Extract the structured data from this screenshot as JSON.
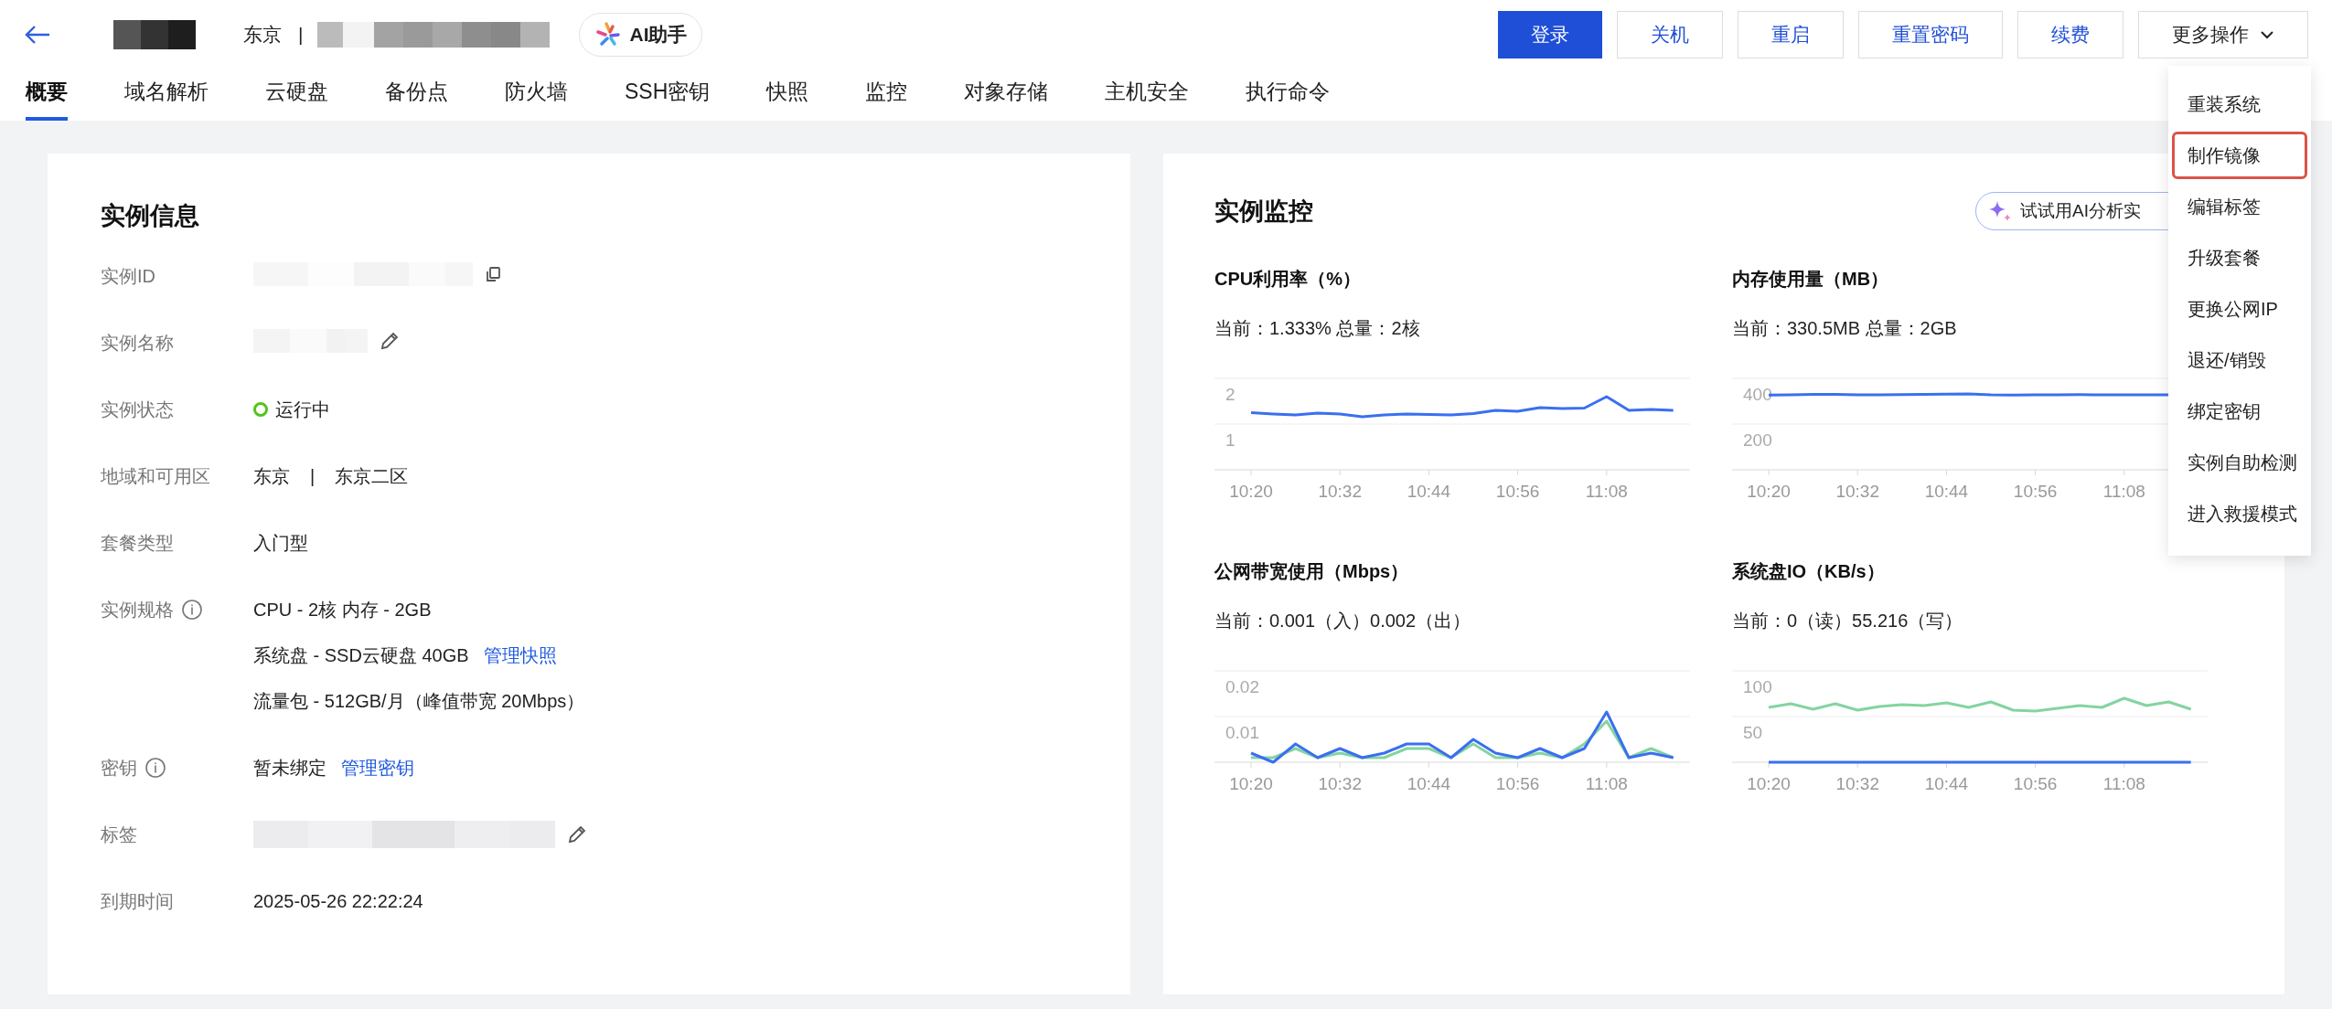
{
  "header": {
    "location": "东京",
    "separator": "|",
    "ai_button": "AI助手",
    "buttons": [
      {
        "label": "登录",
        "kind": "primary"
      },
      {
        "label": "关机",
        "kind": "default"
      },
      {
        "label": "重启",
        "kind": "default"
      },
      {
        "label": "重置密码",
        "kind": "default"
      },
      {
        "label": "续费",
        "kind": "default"
      },
      {
        "label": "更多操作",
        "kind": "menu"
      }
    ]
  },
  "tabs": [
    {
      "label": "概要",
      "selected": true
    },
    {
      "label": "域名解析",
      "selected": false
    },
    {
      "label": "云硬盘",
      "selected": false
    },
    {
      "label": "备份点",
      "selected": false
    },
    {
      "label": "防火墙",
      "selected": false
    },
    {
      "label": "SSH密钥",
      "selected": false
    },
    {
      "label": "快照",
      "selected": false
    },
    {
      "label": "监控",
      "selected": false
    },
    {
      "label": "对象存储",
      "selected": false
    },
    {
      "label": "主机安全",
      "selected": false
    },
    {
      "label": "执行命令",
      "selected": false
    }
  ],
  "instance_info": {
    "title": "实例信息",
    "rows": [
      {
        "label": "实例ID",
        "info": false,
        "kind": "redacted_copy"
      },
      {
        "label": "实例名称",
        "info": false,
        "kind": "redacted_edit"
      },
      {
        "label": "实例状态",
        "info": false,
        "kind": "status",
        "value": "运行中",
        "color": "#52c41a"
      },
      {
        "label": "地域和可用区",
        "info": false,
        "kind": "parts",
        "values": [
          "东京",
          "|",
          "东京二区"
        ]
      },
      {
        "label": "套餐类型",
        "info": false,
        "kind": "text",
        "lines": [
          {
            "text": "入门型"
          }
        ]
      },
      {
        "label": "实例规格",
        "info": true,
        "kind": "text",
        "lines": [
          {
            "text": "CPU - 2核 内存 - 2GB"
          },
          {
            "text": "系统盘 - SSD云硬盘 40GB",
            "link": "管理快照"
          },
          {
            "text": "流量包 - 512GB/月（峰值带宽 20Mbps）"
          }
        ]
      },
      {
        "label": "密钥",
        "info": true,
        "kind": "text",
        "lines": [
          {
            "text": "暂未绑定",
            "link": "管理密钥"
          }
        ]
      },
      {
        "label": "标签",
        "info": false,
        "kind": "redacted_edit"
      },
      {
        "label": "到期时间",
        "info": false,
        "kind": "text",
        "lines": [
          {
            "text": "2025-05-26 22:22:24"
          }
        ]
      }
    ]
  },
  "monitor": {
    "title": "实例监控",
    "ai_button": "试试用AI分析实",
    "charts": [
      {
        "title": "CPU利用率（%）",
        "current": "当前：1.333% 总量：2核",
        "chart_data": {
          "type": "line",
          "categories": [
            "10:20",
            null,
            null,
            null,
            "10:32",
            null,
            null,
            null,
            "10:44",
            null,
            null,
            null,
            "10:56",
            null,
            null,
            null,
            "11:08",
            null,
            null,
            null
          ],
          "ylim": [
            0,
            2
          ],
          "yticks": [
            1,
            2
          ],
          "series": [
            {
              "color": "#3a6ff0",
              "values": [
                1.25,
                1.22,
                1.2,
                1.24,
                1.22,
                1.16,
                1.2,
                1.22,
                1.21,
                1.2,
                1.23,
                1.3,
                1.28,
                1.36,
                1.34,
                1.35,
                1.6,
                1.3,
                1.32,
                1.3
              ]
            }
          ]
        }
      },
      {
        "title": "内存使用量（MB）",
        "current": "当前：330.5MB 总量：2GB",
        "chart_data": {
          "type": "line",
          "categories": [
            "10:20",
            null,
            null,
            null,
            "10:32",
            null,
            null,
            null,
            "10:44",
            null,
            null,
            null,
            "10:56",
            null,
            null,
            null,
            "11:08",
            null,
            null,
            null
          ],
          "ylim": [
            0,
            400
          ],
          "yticks": [
            200,
            400
          ],
          "series": [
            {
              "color": "#3a6ff0",
              "values": [
                327,
                328,
                330,
                330,
                328,
                328,
                329,
                330,
                331,
                332,
                328,
                327,
                328,
                328,
                329,
                328,
                328,
                328,
                328,
                null
              ]
            }
          ]
        }
      },
      {
        "title": "公网带宽使用（Mbps）",
        "current": "当前：0.001（入）0.002（出）",
        "chart_data": {
          "type": "line",
          "categories": [
            "10:20",
            null,
            null,
            null,
            "10:32",
            null,
            null,
            null,
            "10:44",
            null,
            null,
            null,
            "10:56",
            null,
            null,
            null,
            "11:08",
            null,
            null,
            null
          ],
          "ylim": [
            0,
            0.02
          ],
          "yticks": [
            0.01,
            0.02
          ],
          "series": [
            {
              "color": "#84d4a0",
              "values": [
                0.001,
                0.001,
                0.003,
                0.001,
                0.002,
                0.001,
                0.001,
                0.003,
                0.003,
                0.001,
                0.004,
                0.001,
                0.001,
                0.002,
                0.001,
                0.004,
                0.009,
                0.001,
                0.003,
                0.001
              ]
            },
            {
              "color": "#3a6ff0",
              "values": [
                0.002,
                0.0,
                0.004,
                0.001,
                0.003,
                0.001,
                0.002,
                0.004,
                0.004,
                0.001,
                0.005,
                0.002,
                0.001,
                0.003,
                0.001,
                0.003,
                0.011,
                0.001,
                0.002,
                0.001
              ]
            }
          ]
        }
      },
      {
        "title": "系统盘IO（KB/s）",
        "current": "当前：0（读）55.216（写）",
        "chart_data": {
          "type": "line",
          "categories": [
            "10:20",
            null,
            null,
            null,
            "10:32",
            null,
            null,
            null,
            "10:44",
            null,
            null,
            null,
            "10:56",
            null,
            null,
            null,
            "11:08",
            null,
            null,
            null
          ],
          "ylim": [
            0,
            100
          ],
          "yticks": [
            50,
            100
          ],
          "series": [
            {
              "color": "#84d4a0",
              "values": [
                60,
                64,
                58,
                64,
                57,
                61,
                63,
                62,
                65,
                60,
                66,
                57,
                56,
                59,
                62,
                60,
                70,
                62,
                66,
                58
              ]
            },
            {
              "color": "#3a6ff0",
              "values": [
                0,
                0,
                0,
                0,
                0,
                0,
                0,
                0,
                0,
                0,
                0,
                0,
                0,
                0,
                0,
                0,
                0,
                0,
                0,
                0
              ]
            }
          ]
        }
      }
    ]
  },
  "more_menu": {
    "items": [
      {
        "label": "重装系统",
        "outlined": false
      },
      {
        "label": "制作镜像",
        "outlined": true
      },
      {
        "label": "编辑标签",
        "outlined": false
      },
      {
        "label": "升级套餐",
        "outlined": false
      },
      {
        "label": "更换公网IP",
        "outlined": false
      },
      {
        "label": "退还/销毁",
        "outlined": false
      },
      {
        "label": "绑定密钥",
        "outlined": false
      },
      {
        "label": "实例自助检测",
        "outlined": false
      },
      {
        "label": "进入救援模式",
        "outlined": false
      }
    ]
  }
}
